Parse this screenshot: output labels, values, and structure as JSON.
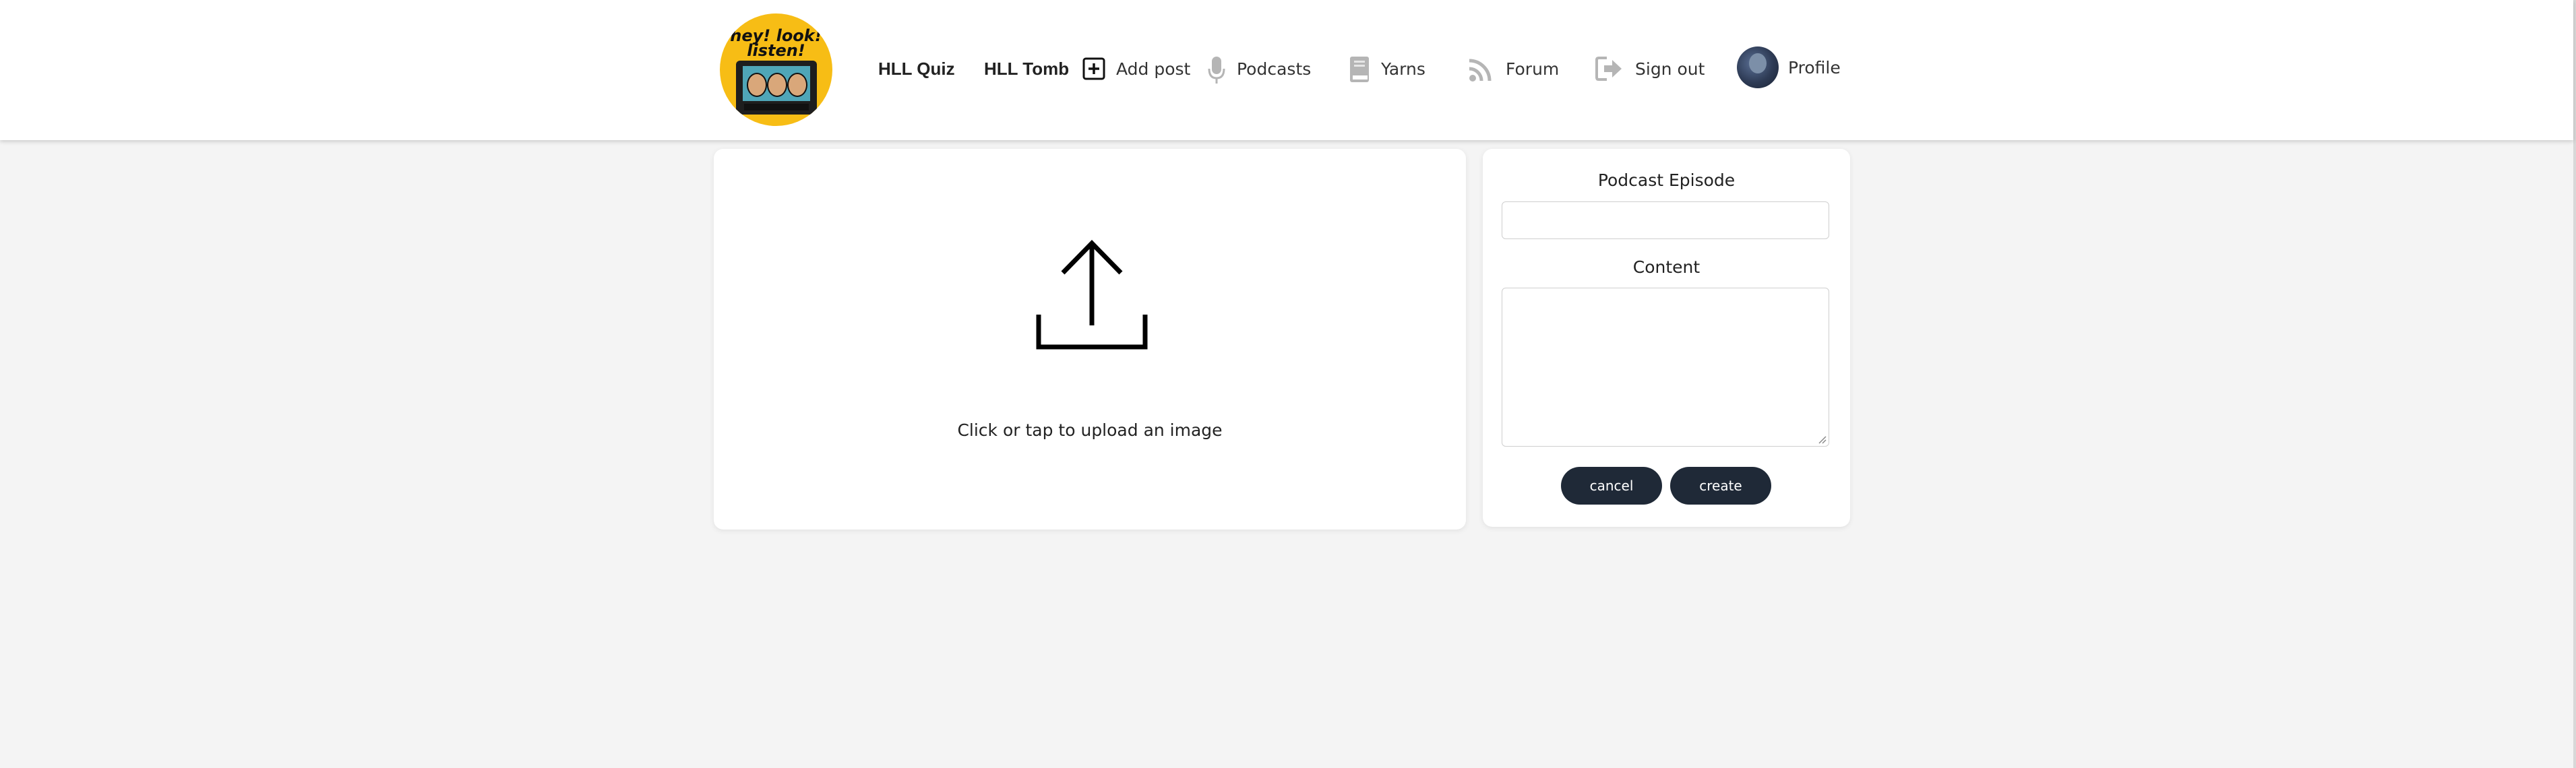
{
  "logo": {
    "alt_text": "hey! look! listen!"
  },
  "nav": {
    "hll_quiz": "HLL Quiz",
    "hll_tomb": "HLL Tomb",
    "add_post": "Add post",
    "podcasts": "Podcasts",
    "yarns": "Yarns",
    "forum": "Forum",
    "sign_out": "Sign out",
    "profile": "Profile"
  },
  "upload": {
    "prompt": "Click or tap to upload an image"
  },
  "form": {
    "episode_label": "Podcast Episode",
    "episode_value": "",
    "content_label": "Content",
    "content_value": "",
    "cancel_label": "cancel",
    "create_label": "create"
  },
  "colors": {
    "header_bg": "#ffffff",
    "page_bg": "#f4f4f4",
    "logo_yellow": "#f7bd15",
    "button_dark": "#1f2937",
    "nav_icon_muted": "#b0b0b0"
  }
}
